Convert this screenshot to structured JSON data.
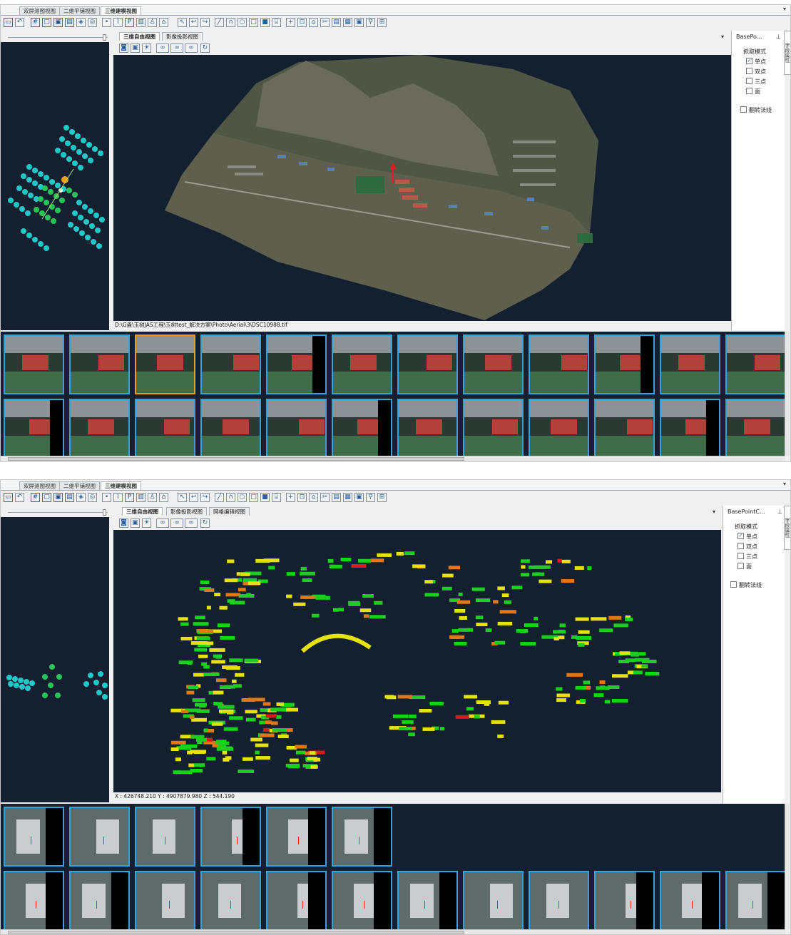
{
  "doc_tabs": [
    "双屏测图视图",
    "二维平铺视图",
    "三维建模视图"
  ],
  "panel1": {
    "view_tabs": [
      "三维自由视图",
      "影像投影视图"
    ],
    "status_text": "D:\\G盘\\玉树JAS工程\\玉树test_解决方案\\Photo\\Aerial\\3\\DSC10988.tif",
    "props": {
      "title": "BasePo...",
      "group_label": "抓取模式",
      "options": [
        {
          "label": "单点",
          "checked": true
        },
        {
          "label": "双点",
          "checked": false
        },
        {
          "label": "三点",
          "checked": false
        },
        {
          "label": "面",
          "checked": false
        }
      ],
      "flip_label": "翻转法线"
    }
  },
  "panel2": {
    "view_tabs": [
      "三维自由视图",
      "影像投影视图",
      "网格编辑视图"
    ],
    "status_text": "X : 426748.210 Y : 4907879.980 Z : 544.190",
    "props": {
      "title": "BasePointC...",
      "group_label": "抓取模式",
      "options": [
        {
          "label": "单点",
          "checked": true
        },
        {
          "label": "双点",
          "checked": false
        },
        {
          "label": "三点",
          "checked": false
        },
        {
          "label": "面",
          "checked": false
        }
      ],
      "flip_label": "翻转法线"
    }
  },
  "side_tab_label": "字段属性",
  "colors": {
    "view_bg": "#14202f",
    "thumb_border": "#31a5d8",
    "thumb_selected": "#f39c12",
    "bldg_green": "#19d11c",
    "bldg_yellow": "#e6e20e",
    "bldg_orange": "#e07818",
    "bldg_red": "#e01818",
    "camera_cyan": "#1ec8c8"
  }
}
